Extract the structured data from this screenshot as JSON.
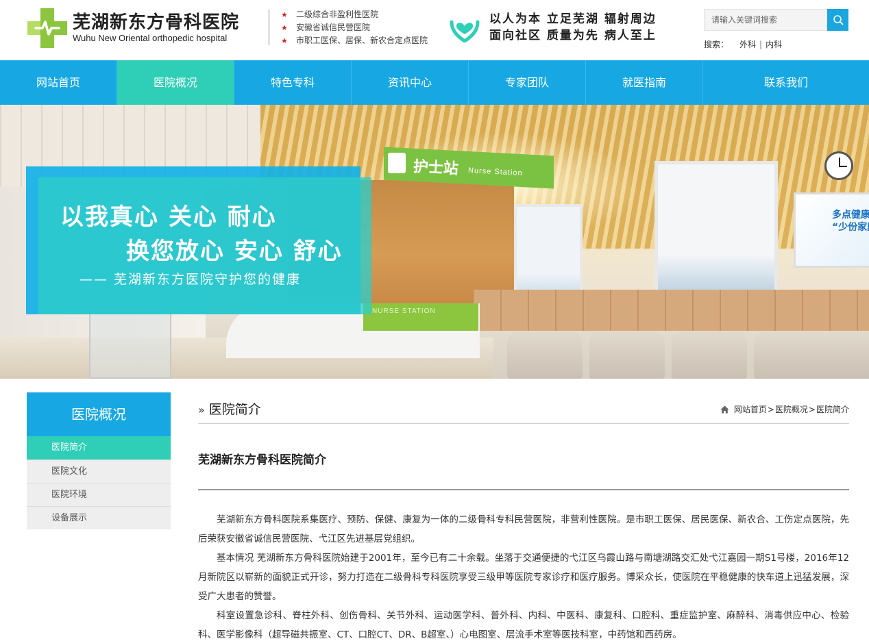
{
  "header": {
    "name_cn": "芜湖新东方骨科医院",
    "name_en": "Wuhu New Oriental orthopedic hospital",
    "badges": [
      "二级综合非盈利性医院",
      "安徽省诚信民营医院",
      "市职工医保、居保、新农合定点医院"
    ],
    "slogan_line1": "以人为本 立足芜湖 辐射周边",
    "slogan_line2": "面向社区 质量为先 病人至上",
    "search": {
      "placeholder": "请输入关键词搜索",
      "hot_label": "搜索：",
      "hot_words": [
        "外科",
        "内科"
      ],
      "separator": "|"
    },
    "colors": {
      "brand": "#17a8e3",
      "accent": "#2fcfb7",
      "logo_green": "#8cc63f"
    }
  },
  "nav": {
    "items": [
      {
        "label": "网站首页"
      },
      {
        "label": "医院概况"
      },
      {
        "label": "特色专科"
      },
      {
        "label": "资讯中心"
      },
      {
        "label": "专家团队"
      },
      {
        "label": "就医指南"
      },
      {
        "label": "联系我们"
      }
    ],
    "active_label": "医院概况"
  },
  "banner": {
    "line1": "以我真心 关心 耐心",
    "line2": "换您放心 安心 舒心",
    "line3": "—— 芜湖新东方医院守护您的健康",
    "sign_cn": "护士站",
    "sign_en": "Nurse  Station",
    "counter_text": "NURSE STATION",
    "poster_text_1": "多点健康关",
    "poster_text_2": "“少份家庭"
  },
  "sidebar": {
    "title": "医院概况",
    "items": [
      {
        "label": "医院简介"
      },
      {
        "label": "医院文化"
      },
      {
        "label": "医院环境"
      },
      {
        "label": "设备展示"
      }
    ],
    "active_label": "医院简介"
  },
  "main": {
    "heading": "医院简介",
    "breadcrumb": [
      "网站首页",
      "医院概况",
      "医院简介"
    ],
    "breadcrumb_sep": ">",
    "article_title": "芜湖新东方骨科医院简介",
    "paragraphs": [
      "芜湖新东方骨科医院系集医疗、预防、保健、康复为一体的二级骨科专科民营医院，非营利性医院。是市职工医保、居民医保、新农合、工伤定点医院，先后荣获安徽省诚信民营医院、弋江区先进基层党组织。",
      "基本情况 芜湖新东方骨科医院始建于2001年，至今已有二十余载。坐落于交通便捷的弋江区乌霞山路与南塘湖路交汇处弋江嘉园一期S1号楼，2016年12月新院区以崭新的面貌正式开诊，努力打造在二级骨科专科医院享受三级甲等医院专家诊疗和医疗服务。博采众长，使医院在平稳健康的快车道上迅猛发展，深受广大患者的赞誉。",
      "科室设置急诊科、脊柱外科、创伤骨科、关节外科、运动医学科、普外科、内科、中医科、康复科、口腔科、重症监护室、麻醉科、消毒供应中心、检验科、医学影像科（超导磁共振室、CT、口腔CT、DR、B超室、）心电图室、层流手术室等医技科室，中药馆和西药房。"
    ]
  }
}
